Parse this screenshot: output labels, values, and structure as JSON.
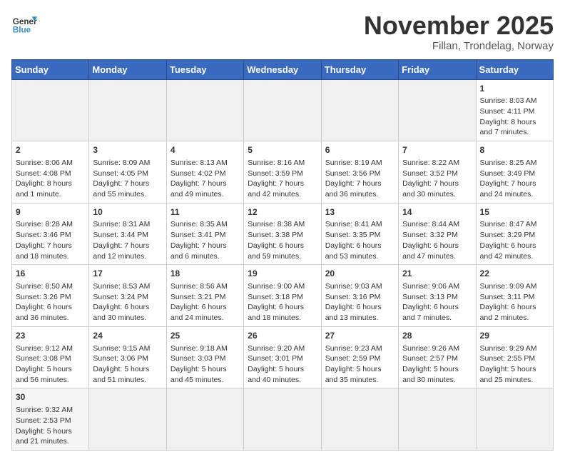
{
  "logo": {
    "text_general": "General",
    "text_blue": "Blue"
  },
  "calendar": {
    "title": "November 2025",
    "subtitle": "Fillan, Trondelag, Norway",
    "days_of_week": [
      "Sunday",
      "Monday",
      "Tuesday",
      "Wednesday",
      "Thursday",
      "Friday",
      "Saturday"
    ],
    "weeks": [
      [
        {
          "day": "",
          "info": "",
          "empty": true
        },
        {
          "day": "",
          "info": "",
          "empty": true
        },
        {
          "day": "",
          "info": "",
          "empty": true
        },
        {
          "day": "",
          "info": "",
          "empty": true
        },
        {
          "day": "",
          "info": "",
          "empty": true
        },
        {
          "day": "",
          "info": "",
          "empty": true
        },
        {
          "day": "1",
          "info": "Sunrise: 8:03 AM\nSunset: 4:11 PM\nDaylight: 8 hours and 7 minutes.",
          "empty": false
        }
      ],
      [
        {
          "day": "2",
          "info": "Sunrise: 8:06 AM\nSunset: 4:08 PM\nDaylight: 8 hours and 1 minute.",
          "empty": false
        },
        {
          "day": "3",
          "info": "Sunrise: 8:09 AM\nSunset: 4:05 PM\nDaylight: 7 hours and 55 minutes.",
          "empty": false
        },
        {
          "day": "4",
          "info": "Sunrise: 8:13 AM\nSunset: 4:02 PM\nDaylight: 7 hours and 49 minutes.",
          "empty": false
        },
        {
          "day": "5",
          "info": "Sunrise: 8:16 AM\nSunset: 3:59 PM\nDaylight: 7 hours and 42 minutes.",
          "empty": false
        },
        {
          "day": "6",
          "info": "Sunrise: 8:19 AM\nSunset: 3:56 PM\nDaylight: 7 hours and 36 minutes.",
          "empty": false
        },
        {
          "day": "7",
          "info": "Sunrise: 8:22 AM\nSunset: 3:52 PM\nDaylight: 7 hours and 30 minutes.",
          "empty": false
        },
        {
          "day": "8",
          "info": "Sunrise: 8:25 AM\nSunset: 3:49 PM\nDaylight: 7 hours and 24 minutes.",
          "empty": false
        }
      ],
      [
        {
          "day": "9",
          "info": "Sunrise: 8:28 AM\nSunset: 3:46 PM\nDaylight: 7 hours and 18 minutes.",
          "empty": false
        },
        {
          "day": "10",
          "info": "Sunrise: 8:31 AM\nSunset: 3:44 PM\nDaylight: 7 hours and 12 minutes.",
          "empty": false
        },
        {
          "day": "11",
          "info": "Sunrise: 8:35 AM\nSunset: 3:41 PM\nDaylight: 7 hours and 6 minutes.",
          "empty": false
        },
        {
          "day": "12",
          "info": "Sunrise: 8:38 AM\nSunset: 3:38 PM\nDaylight: 6 hours and 59 minutes.",
          "empty": false
        },
        {
          "day": "13",
          "info": "Sunrise: 8:41 AM\nSunset: 3:35 PM\nDaylight: 6 hours and 53 minutes.",
          "empty": false
        },
        {
          "day": "14",
          "info": "Sunrise: 8:44 AM\nSunset: 3:32 PM\nDaylight: 6 hours and 47 minutes.",
          "empty": false
        },
        {
          "day": "15",
          "info": "Sunrise: 8:47 AM\nSunset: 3:29 PM\nDaylight: 6 hours and 42 minutes.",
          "empty": false
        }
      ],
      [
        {
          "day": "16",
          "info": "Sunrise: 8:50 AM\nSunset: 3:26 PM\nDaylight: 6 hours and 36 minutes.",
          "empty": false
        },
        {
          "day": "17",
          "info": "Sunrise: 8:53 AM\nSunset: 3:24 PM\nDaylight: 6 hours and 30 minutes.",
          "empty": false
        },
        {
          "day": "18",
          "info": "Sunrise: 8:56 AM\nSunset: 3:21 PM\nDaylight: 6 hours and 24 minutes.",
          "empty": false
        },
        {
          "day": "19",
          "info": "Sunrise: 9:00 AM\nSunset: 3:18 PM\nDaylight: 6 hours and 18 minutes.",
          "empty": false
        },
        {
          "day": "20",
          "info": "Sunrise: 9:03 AM\nSunset: 3:16 PM\nDaylight: 6 hours and 13 minutes.",
          "empty": false
        },
        {
          "day": "21",
          "info": "Sunrise: 9:06 AM\nSunset: 3:13 PM\nDaylight: 6 hours and 7 minutes.",
          "empty": false
        },
        {
          "day": "22",
          "info": "Sunrise: 9:09 AM\nSunset: 3:11 PM\nDaylight: 6 hours and 2 minutes.",
          "empty": false
        }
      ],
      [
        {
          "day": "23",
          "info": "Sunrise: 9:12 AM\nSunset: 3:08 PM\nDaylight: 5 hours and 56 minutes.",
          "empty": false
        },
        {
          "day": "24",
          "info": "Sunrise: 9:15 AM\nSunset: 3:06 PM\nDaylight: 5 hours and 51 minutes.",
          "empty": false
        },
        {
          "day": "25",
          "info": "Sunrise: 9:18 AM\nSunset: 3:03 PM\nDaylight: 5 hours and 45 minutes.",
          "empty": false
        },
        {
          "day": "26",
          "info": "Sunrise: 9:20 AM\nSunset: 3:01 PM\nDaylight: 5 hours and 40 minutes.",
          "empty": false
        },
        {
          "day": "27",
          "info": "Sunrise: 9:23 AM\nSunset: 2:59 PM\nDaylight: 5 hours and 35 minutes.",
          "empty": false
        },
        {
          "day": "28",
          "info": "Sunrise: 9:26 AM\nSunset: 2:57 PM\nDaylight: 5 hours and 30 minutes.",
          "empty": false
        },
        {
          "day": "29",
          "info": "Sunrise: 9:29 AM\nSunset: 2:55 PM\nDaylight: 5 hours and 25 minutes.",
          "empty": false
        }
      ],
      [
        {
          "day": "30",
          "info": "Sunrise: 9:32 AM\nSunset: 2:53 PM\nDaylight: 5 hours and 21 minutes.",
          "empty": false
        },
        {
          "day": "",
          "info": "",
          "empty": true
        },
        {
          "day": "",
          "info": "",
          "empty": true
        },
        {
          "day": "",
          "info": "",
          "empty": true
        },
        {
          "day": "",
          "info": "",
          "empty": true
        },
        {
          "day": "",
          "info": "",
          "empty": true
        },
        {
          "day": "",
          "info": "",
          "empty": true
        }
      ]
    ]
  }
}
